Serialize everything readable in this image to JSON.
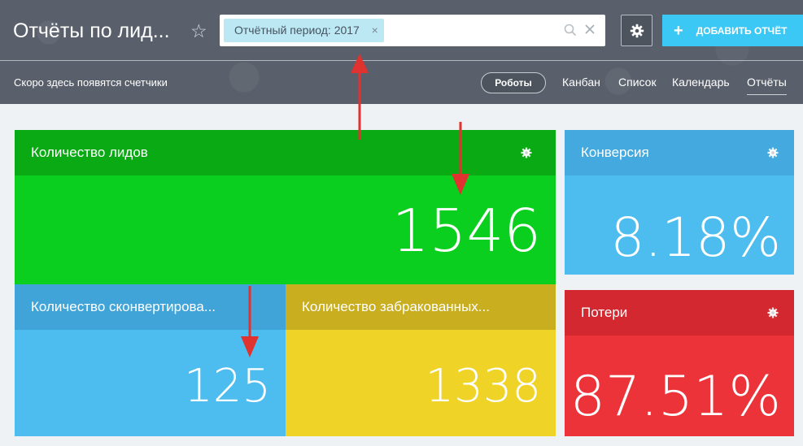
{
  "header": {
    "title": "Отчёты по лид...",
    "star": "☆",
    "filter_chip": "Отчётный период: 2017",
    "chip_close": "×",
    "add_button": "ДОБАВИТЬ ОТЧЁТ",
    "add_plus": "+"
  },
  "subbar": {
    "hint": "Скоро здесь появятся счетчики",
    "robots": "Роботы",
    "nav": [
      "Канбан",
      "Список",
      "Календарь",
      "Отчёты"
    ],
    "active_nav": "Отчёты"
  },
  "tiles": {
    "leads": {
      "title": "Количество лидов",
      "value": "1546",
      "head_color": "#0aaa14",
      "body_color": "#0bcf1f"
    },
    "converted": {
      "title": "Количество сконвертирова...",
      "value": "125",
      "head_color": "#41a4d9",
      "body_color": "#4dbcee"
    },
    "rejected": {
      "title": "Количество забракованных...",
      "value": "1338",
      "head_color": "#c9ae1f",
      "body_color": "#f0d327"
    },
    "conversion": {
      "title": "Конверсия",
      "value": "8.18%",
      "head_color": "#44a9de",
      "body_color": "#4dbcee"
    },
    "losses": {
      "title": "Потери",
      "value": "87.51%",
      "head_color": "#d3282f",
      "body_color": "#eb3339"
    }
  },
  "icons": {
    "star": "star-icon",
    "search": "search-icon",
    "clear": "close-icon",
    "settings": "gear-icon",
    "tile_settings": "gear-icon"
  },
  "colors": {
    "header_bg": "#59606b",
    "accent": "#3bc8f5",
    "annotation_arrow": "#e0322f"
  }
}
